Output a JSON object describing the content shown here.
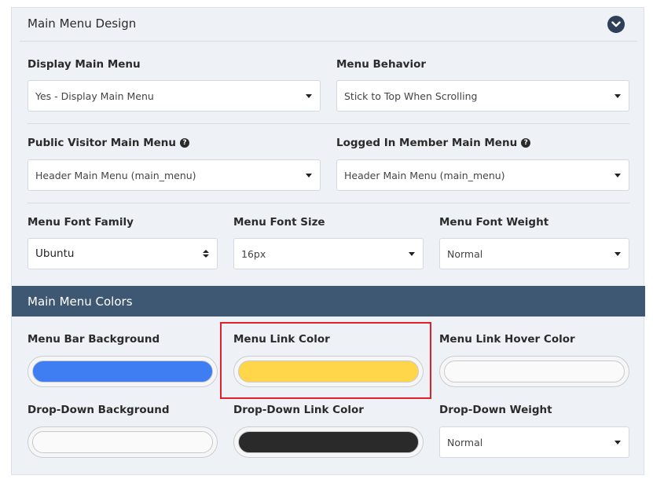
{
  "design": {
    "title": "Main Menu Design",
    "display_main_menu": {
      "label": "Display Main Menu",
      "value": "Yes - Display Main Menu"
    },
    "menu_behavior": {
      "label": "Menu Behavior",
      "value": "Stick to Top When Scrolling"
    },
    "public_visitor_menu": {
      "label": "Public Visitor Main Menu",
      "value": "Header Main Menu (main_menu)",
      "help": "?"
    },
    "logged_in_menu": {
      "label": "Logged In Member Main Menu",
      "value": "Header Main Menu (main_menu)",
      "help": "?"
    },
    "font_family": {
      "label": "Menu Font Family",
      "value": "Ubuntu"
    },
    "font_size": {
      "label": "Menu Font Size",
      "value": "16px"
    },
    "font_weight": {
      "label": "Menu Font Weight",
      "value": "Normal"
    }
  },
  "colors": {
    "title": "Main Menu Colors",
    "menu_bar_background": {
      "label": "Menu Bar Background",
      "color": "#3f7ef2"
    },
    "menu_link_color": {
      "label": "Menu Link Color",
      "color": "#ffd54a"
    },
    "menu_link_hover_color": {
      "label": "Menu Link Hover Color",
      "color": "#fafafa"
    },
    "dropdown_background": {
      "label": "Drop-Down Background",
      "color": "#fafafa"
    },
    "dropdown_link_color": {
      "label": "Drop-Down Link Color",
      "color": "#2a2a2a"
    },
    "dropdown_weight": {
      "label": "Drop-Down Weight",
      "value": "Normal"
    }
  }
}
